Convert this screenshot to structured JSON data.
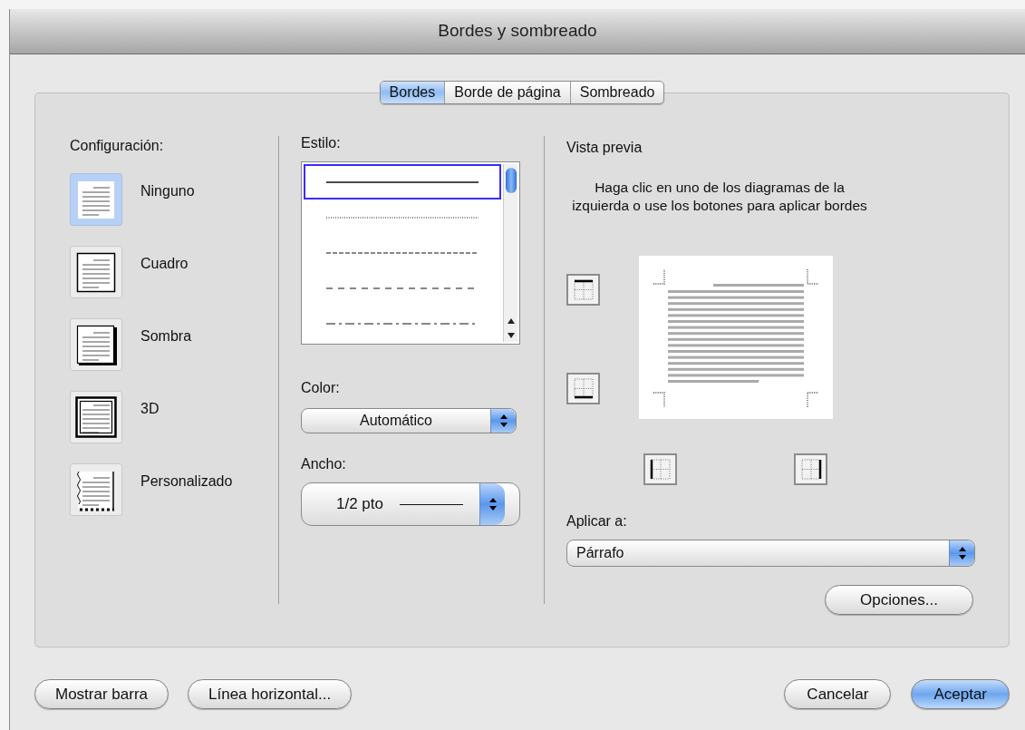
{
  "window": {
    "title": "Bordes y sombreado"
  },
  "tabs": [
    {
      "label": "Bordes",
      "selected": true
    },
    {
      "label": "Borde de página",
      "selected": false
    },
    {
      "label": "Sombreado",
      "selected": false
    }
  ],
  "settings": {
    "label": "Configuración:",
    "items": [
      {
        "kind": "none",
        "label": "Ninguno",
        "selected": true
      },
      {
        "kind": "box",
        "label": "Cuadro",
        "selected": false
      },
      {
        "kind": "shadow",
        "label": "Sombra",
        "selected": false
      },
      {
        "kind": "double",
        "label": "3D",
        "selected": false
      },
      {
        "kind": "custom",
        "label": "Personalizado",
        "selected": false
      }
    ]
  },
  "style": {
    "label": "Estilo:",
    "items": [
      {
        "kind": "solid",
        "selected": true
      },
      {
        "kind": "dotted",
        "selected": false
      },
      {
        "kind": "dashed",
        "selected": false
      },
      {
        "kind": "wide-dashed",
        "selected": false
      },
      {
        "kind": "dash-dot",
        "selected": false
      }
    ]
  },
  "color": {
    "label": "Color:",
    "value": "Automático"
  },
  "width": {
    "label": "Ancho:",
    "value": "1/2 pto"
  },
  "preview": {
    "label": "Vista previa",
    "instruction": "Haga clic en uno de los diagramas de la izquierda o use los botones para aplicar bordes",
    "buttons": [
      {
        "kind": "top"
      },
      {
        "kind": "bottom"
      },
      {
        "kind": "left"
      },
      {
        "kind": "right"
      }
    ]
  },
  "apply_to": {
    "label": "Aplicar a:",
    "value": "Párrafo"
  },
  "options_button": "Opciones...",
  "left_buttons": [
    {
      "label": "Mostrar barra",
      "default": false
    },
    {
      "label": "Línea horizontal...",
      "default": false
    }
  ],
  "right_buttons": [
    {
      "label": "Cancelar",
      "default": false
    },
    {
      "label": "Aceptar",
      "default": true
    }
  ]
}
